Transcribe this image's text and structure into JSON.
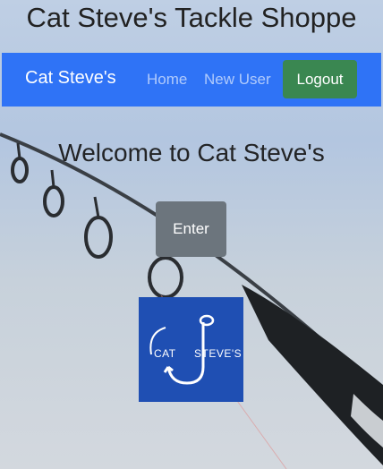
{
  "header": {
    "site_title": "Cat Steve's Tackle Shoppe"
  },
  "navbar": {
    "brand": "Cat Steve's",
    "links": [
      "Home",
      "New User"
    ],
    "logout_label": "Logout",
    "colors": {
      "background": "#2f73f6",
      "logout": "#3a8751"
    }
  },
  "main": {
    "welcome_text": "Welcome to Cat Steve's",
    "enter_label": "Enter",
    "logo": {
      "icon": "fish-hook-icon",
      "text_left": "CAT",
      "text_right": "STEVE'S",
      "background": "#1f4fb3"
    }
  }
}
